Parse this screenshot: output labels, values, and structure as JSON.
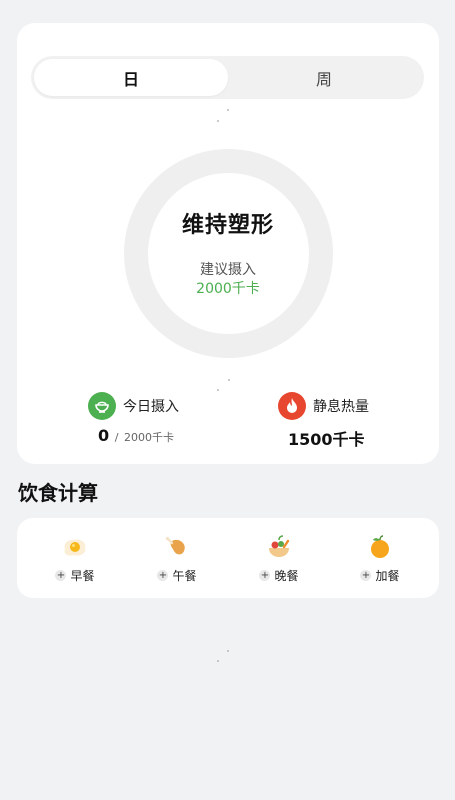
{
  "tabs": [
    {
      "label": "日",
      "active": true
    },
    {
      "label": "周",
      "active": false
    }
  ],
  "goal": {
    "title": "维持塑形",
    "suggest_label": "建议摄入",
    "suggest_value": "2000千卡"
  },
  "stats": {
    "intake": {
      "icon": "rice-bowl-icon",
      "label": "今日摄入",
      "value": "0",
      "separator": "/",
      "target": "2000千卡"
    },
    "resting": {
      "icon": "flame-icon",
      "label": "静息热量",
      "value": "1500千卡"
    }
  },
  "section": {
    "title": "饮食计算"
  },
  "meals": [
    {
      "icon": "fried-egg-icon",
      "label": "早餐"
    },
    {
      "icon": "chicken-leg-icon",
      "label": "午餐"
    },
    {
      "icon": "salad-bowl-icon",
      "label": "晚餐"
    },
    {
      "icon": "orange-icon",
      "label": "加餐"
    }
  ],
  "colors": {
    "accent_green": "#4cae4f",
    "flame_red": "#e8472f",
    "bowl_green": "#4caf50"
  }
}
